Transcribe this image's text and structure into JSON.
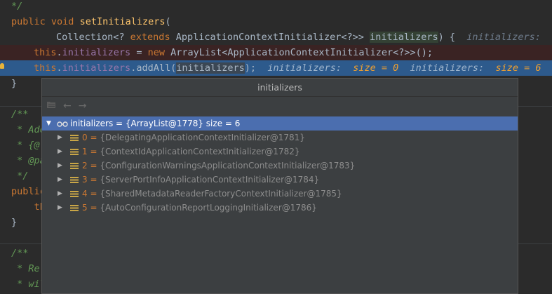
{
  "editor": {
    "l1": "*/",
    "l2_kw1": "public",
    "l2_kw2": "void",
    "l2_fn": "setInitializers",
    "l2_rest": "(",
    "l3_type1": "Collection<? ",
    "l3_kw": "extends",
    "l3_type2": " ApplicationContextInitializer<?>> ",
    "l3_param": "initializers",
    "l3_rest": ") {  ",
    "l3_hint": "initializers:  s",
    "l4_kw": "this",
    "l4_dot": ".",
    "l4_fld": "initializers",
    "l4_eq": " = ",
    "l4_new": "new",
    "l4_rest": " ArrayList<ApplicationContextInitializer<?>>();",
    "l5_kw": "this",
    "l5_dot": ".",
    "l5_fld": "initializers",
    "l5_call": ".addAll(",
    "l5_arg": "initializers",
    "l5_end": ");",
    "l5_hint1": "initializers:  ",
    "l5_hint1v": "size = 0",
    "l5_hint2": "initializers:  ",
    "l5_hint2v": "size = 6",
    "l6": "}",
    "l7": "/**",
    "l8": " * Add",
    "l9": " * {@",
    "l10": " * @pa",
    "l11": " */",
    "l12": "public",
    "l13": "    th",
    "l14": "}",
    "l15": "/**",
    "l16": " * Re",
    "l17": " * wil"
  },
  "popup": {
    "title": "initializers",
    "root_label": "initializers = {ArrayList@1778}  size = 6",
    "items": [
      {
        "index": "0 = ",
        "value": "{DelegatingApplicationContextInitializer@1781}"
      },
      {
        "index": "1 = ",
        "value": "{ContextIdApplicationContextInitializer@1782}"
      },
      {
        "index": "2 = ",
        "value": "{ConfigurationWarningsApplicationContextInitializer@1783}"
      },
      {
        "index": "3 = ",
        "value": "{ServerPortInfoApplicationContextInitializer@1784}"
      },
      {
        "index": "4 = ",
        "value": "{SharedMetadataReaderFactoryContextInitializer@1785}"
      },
      {
        "index": "5 = ",
        "value": "{AutoConfigurationReportLoggingInitializer@1786}"
      }
    ],
    "icons": [
      "folder-icon",
      "back-arrow-icon",
      "forward-arrow-icon",
      "glasses-icon",
      "field-icon"
    ]
  }
}
